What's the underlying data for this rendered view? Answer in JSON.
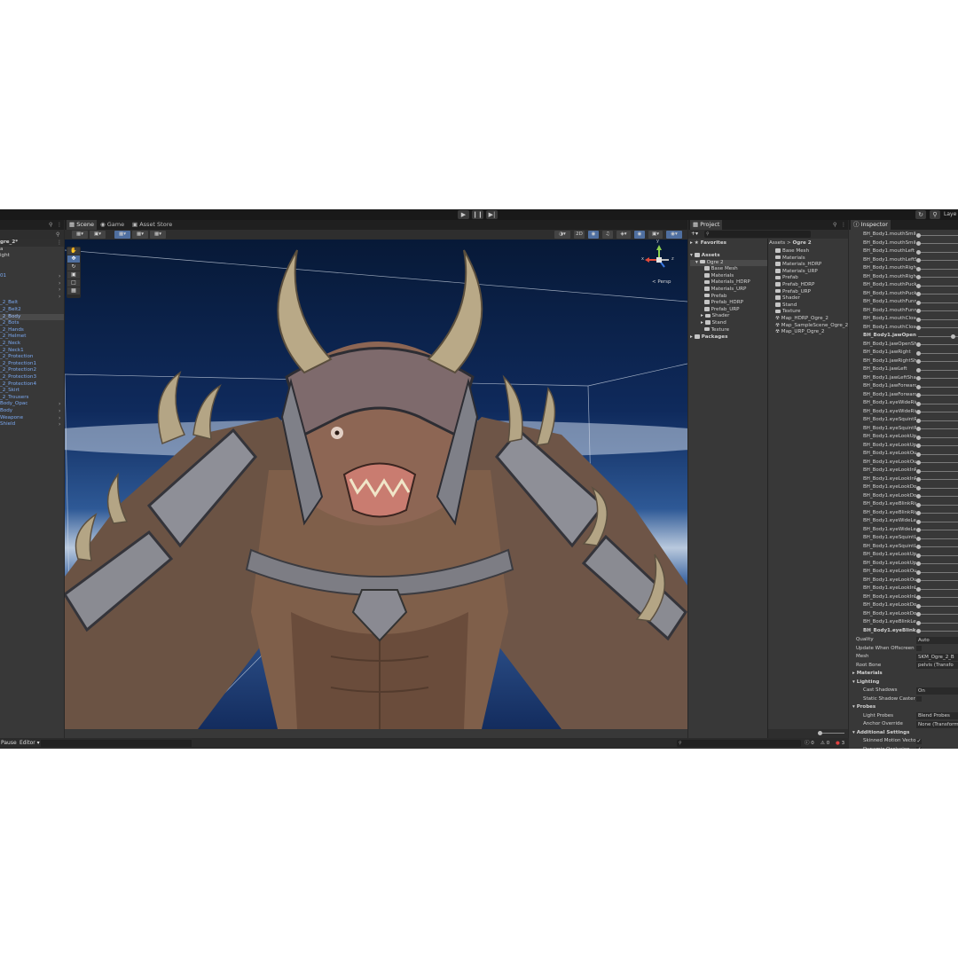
{
  "toolbar": {
    "play_icon": "play-icon",
    "pause_icon": "pause-icon",
    "step_icon": "step-icon",
    "layers_label": "Laye"
  },
  "hierarchy": {
    "title_fragment": "gre_2*",
    "items": [
      {
        "label": "a",
        "color": "white"
      },
      {
        "label": "ight",
        "color": "white"
      },
      {
        "label": "",
        "color": "white"
      },
      {
        "label": "",
        "color": "white"
      },
      {
        "label": "01",
        "color": "blue"
      },
      {
        "label": "",
        "color": "blue"
      },
      {
        "label": "",
        "color": "blue"
      },
      {
        "label": "",
        "color": "blue"
      },
      {
        "label": "_2_Belt",
        "color": "blue"
      },
      {
        "label": "_2_Belt2",
        "color": "blue"
      },
      {
        "label": "_2_Body",
        "color": "blue",
        "selected": true
      },
      {
        "label": "_2_Bots",
        "color": "blue"
      },
      {
        "label": "_2_Hands",
        "color": "blue"
      },
      {
        "label": "_2_Helmet",
        "color": "blue"
      },
      {
        "label": "_2_Neck",
        "color": "blue"
      },
      {
        "label": "_2_Neck1",
        "color": "blue"
      },
      {
        "label": "_2_Protection",
        "color": "blue"
      },
      {
        "label": "_2_Protection1",
        "color": "blue"
      },
      {
        "label": "_2_Protection2",
        "color": "blue"
      },
      {
        "label": "_2_Protection3",
        "color": "blue"
      },
      {
        "label": "_2_Protection4",
        "color": "blue"
      },
      {
        "label": "_2_Skirt",
        "color": "blue"
      },
      {
        "label": "_2_Trousers",
        "color": "blue"
      },
      {
        "label": "Body_Opac",
        "color": "blue"
      },
      {
        "label": "Body",
        "color": "blue"
      },
      {
        "label": "Weapone",
        "color": "blue"
      },
      {
        "label": "Shield",
        "color": "blue"
      }
    ]
  },
  "scene": {
    "tabs": [
      {
        "label": "Scene",
        "icon": "scene-icon"
      },
      {
        "label": "Game",
        "icon": "game-icon"
      },
      {
        "label": "Asset Store",
        "icon": "store-icon"
      }
    ],
    "persp_label": "< Persp",
    "gizmo_axes": {
      "y": "y",
      "x": "x",
      "z": "z"
    },
    "tools": [
      "hand-tool-icon",
      "move-tool-icon",
      "rotate-tool-icon",
      "scale-tool-icon",
      "rect-tool-icon",
      "transform-tool-icon"
    ]
  },
  "project": {
    "tab_label": "Project",
    "favorites_label": "Favorites",
    "assets_label": "Assets",
    "packages_label": "Packages",
    "tree": [
      {
        "label": "Ogre 2",
        "indent": 1
      },
      {
        "label": "Base Mesh",
        "indent": 2
      },
      {
        "label": "Materials",
        "indent": 2
      },
      {
        "label": "Materials_HDRP",
        "indent": 2
      },
      {
        "label": "Materials_URP",
        "indent": 2
      },
      {
        "label": "Prefab",
        "indent": 2
      },
      {
        "label": "Prefab_HDRP",
        "indent": 2
      },
      {
        "label": "Prefab_URP",
        "indent": 2
      },
      {
        "label": "Shader",
        "indent": 2
      },
      {
        "label": "Stand",
        "indent": 2
      },
      {
        "label": "Texture",
        "indent": 2
      }
    ],
    "breadcrumb": {
      "root": "Assets",
      "sep": ">",
      "leaf": "Ogre 2"
    },
    "files": [
      {
        "label": "Base Mesh",
        "type": "folder"
      },
      {
        "label": "Materials",
        "type": "folder"
      },
      {
        "label": "Materials_HDRP",
        "type": "folder"
      },
      {
        "label": "Materials_URP",
        "type": "folder"
      },
      {
        "label": "Prefab",
        "type": "folder"
      },
      {
        "label": "Prefab_HDRP",
        "type": "folder"
      },
      {
        "label": "Prefab_URP",
        "type": "folder"
      },
      {
        "label": "Shader",
        "type": "folder"
      },
      {
        "label": "Stand",
        "type": "folder"
      },
      {
        "label": "Texture",
        "type": "folder"
      },
      {
        "label": "Map_HDRP_Ogre_2",
        "type": "scene"
      },
      {
        "label": "Map_SampleScene_Ogre_2",
        "type": "scene"
      },
      {
        "label": "Map_URP_Ogre_2",
        "type": "scene"
      }
    ]
  },
  "inspector": {
    "tab_label": "Inspector",
    "blendshapes": [
      "BH_Body1.mouthSmile",
      "BH_Body1.mouthSmile",
      "BH_Body1.mouthLeft",
      "BH_Body1.mouthLeftS",
      "BH_Body1.mouthRight",
      "BH_Body1.mouthRight",
      "BH_Body1.mouthPuck",
      "BH_Body1.mouthPuck",
      "BH_Body1.mouthFunn",
      "BH_Body1.mouthFunn",
      "BH_Body1.mouthClose",
      "BH_Body1.mouthClose",
      "BH_Body1.jawOpen",
      "BH_Body1.jawOpenSh",
      "BH_Body1.jawRight",
      "BH_Body1.jawRightSh",
      "BH_Body1.jawLeft",
      "BH_Body1.jawLeftSha",
      "BH_Body1.jawForward",
      "BH_Body1.jawForward",
      "BH_Body1.eyeWideRig",
      "BH_Body1.eyeWideRig",
      "BH_Body1.eyeSquintR",
      "BH_Body1.eyeSquintR",
      "BH_Body1.eyeLookUp",
      "BH_Body1.eyeLookUp",
      "BH_Body1.eyeLookOu",
      "BH_Body1.eyeLookOu",
      "BH_Body1.eyeLookInR",
      "BH_Body1.eyeLookInR",
      "BH_Body1.eyeLookDo",
      "BH_Body1.eyeLookDo",
      "BH_Body1.eyeBlinkRig",
      "BH_Body1.eyeBlinkRig",
      "BH_Body1.eyeWideLef",
      "BH_Body1.eyeWideLef",
      "BH_Body1.eyeSquintL",
      "BH_Body1.eyeSquintL",
      "BH_Body1.eyeLookUp",
      "BH_Body1.eyeLookUp",
      "BH_Body1.eyeLookOu",
      "BH_Body1.eyeLookOu",
      "BH_Body1.eyeLookInL",
      "BH_Body1.eyeLookInL",
      "BH_Body1.eyeLookDo",
      "BH_Body1.eyeLookDo",
      "BH_Body1.eyeBlinkLef",
      "BH_Body1.eyeBlinkLe"
    ],
    "properties": [
      {
        "label": "Quality",
        "value": "Auto",
        "indent": 8
      },
      {
        "label": "Update When Offscreen",
        "value": "",
        "indent": 8,
        "checkbox": true
      },
      {
        "label": "Mesh",
        "value": "SKM_Ogre_2_B",
        "indent": 8
      },
      {
        "label": "Root Bone",
        "value": "pelvis (Transfo",
        "indent": 8
      },
      {
        "label": "Materials",
        "value": null,
        "indent": 4,
        "header": true
      },
      {
        "label": "Lighting",
        "value": null,
        "indent": 4,
        "header": true
      },
      {
        "label": "Cast Shadows",
        "value": "On",
        "indent": 16
      },
      {
        "label": "Static Shadow Caster",
        "value": "",
        "indent": 16,
        "checkbox": true
      },
      {
        "label": "Probes",
        "value": null,
        "indent": 4,
        "header": true
      },
      {
        "label": "Light Probes",
        "value": "Blend Probes",
        "indent": 16
      },
      {
        "label": "Anchor Override",
        "value": "None (Transform",
        "indent": 16
      },
      {
        "label": "Additional Settings",
        "value": null,
        "indent": 4,
        "header": true
      },
      {
        "label": "Skinned Motion Vecto",
        "value": "✓",
        "indent": 16,
        "checkbox": true
      },
      {
        "label": "Dynamic Occlusion",
        "value": "✓",
        "indent": 16,
        "checkbox": true
      }
    ]
  },
  "status": {
    "pause_label": "Pause",
    "editor_label": "Editor ▾",
    "warnings_count": "0",
    "messages_count": "0",
    "errors_count": "3"
  },
  "colors": {
    "editor_bg": "#282828",
    "panel_bg": "#383838",
    "hierarchy_blue": "#7aa8f0",
    "selection": "#4a4a4a",
    "error_red": "#e04040"
  }
}
